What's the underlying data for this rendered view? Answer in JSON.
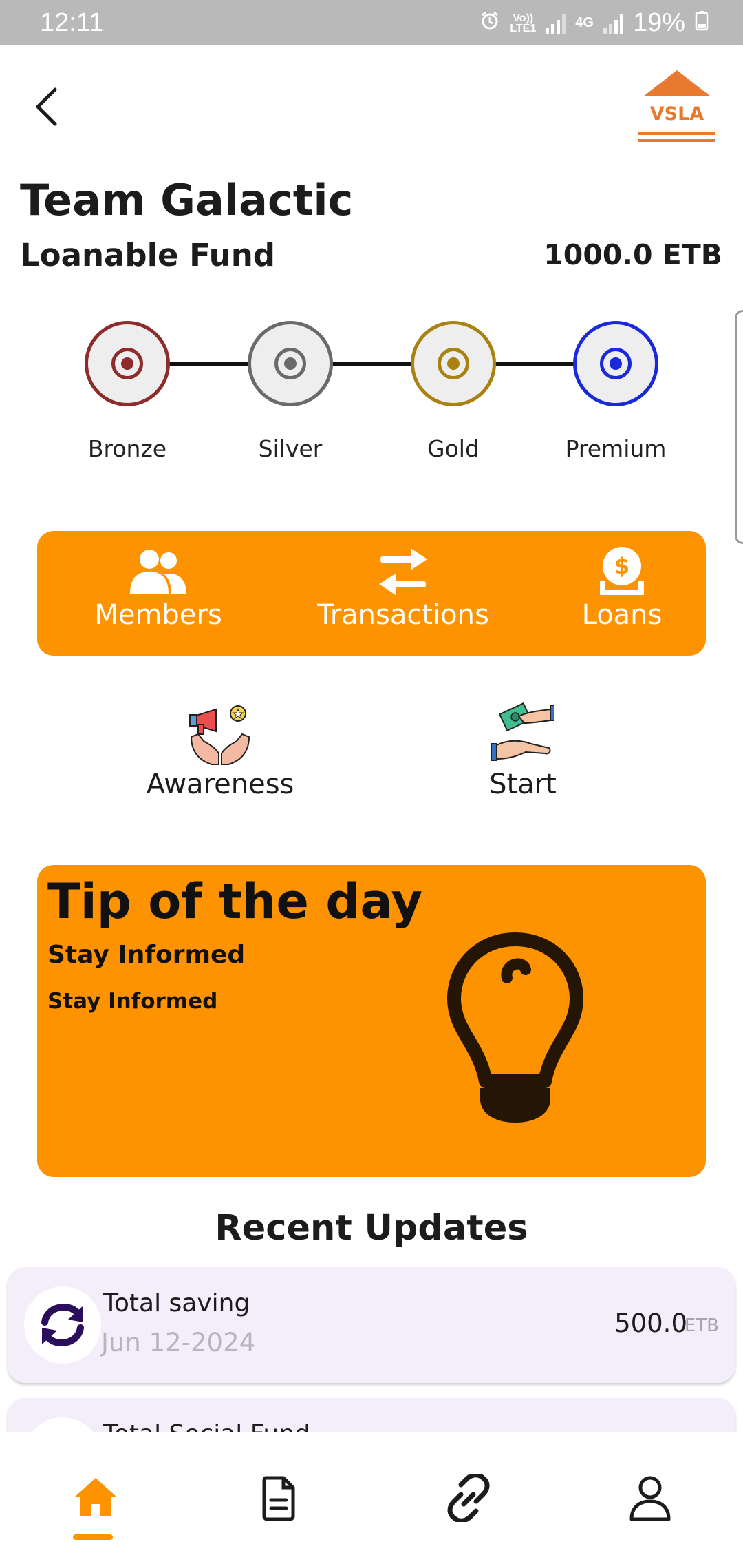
{
  "status_bar": {
    "time": "12:11",
    "network_label_top": "Vo))",
    "network_label_bottom": "LTE1",
    "network_type": "4G",
    "battery": "19%"
  },
  "header": {
    "logo_text": "VSLA",
    "team_name": "Team Galactic",
    "fund_label": "Loanable Fund",
    "fund_value": "1000.0 ETB"
  },
  "tiers": [
    {
      "label": "Bronze",
      "color": "#8e2b2b"
    },
    {
      "label": "Silver",
      "color": "#6a6a6a"
    },
    {
      "label": "Gold",
      "color": "#a98212"
    },
    {
      "label": "Premium",
      "color": "#1a2ad8"
    }
  ],
  "menu": {
    "members_label": "Members",
    "transactions_label": "Transactions",
    "loans_label": "Loans",
    "members_icon": "users-icon",
    "transactions_icon": "arrows-exchange-icon",
    "loans_icon": "money-hand-icon"
  },
  "actions": {
    "awareness_label": "Awareness",
    "start_label": "Start"
  },
  "tip": {
    "title": "Tip of the day",
    "subtitle": "Stay Informed",
    "body": "Stay Informed",
    "icon": "lightbulb-icon"
  },
  "updates": {
    "title": "Recent Updates",
    "items": [
      {
        "label": "Total saving",
        "date": "Jun 12-2024",
        "amount": "500.0",
        "unit": "ETB"
      },
      {
        "label": "Total Social Fund",
        "date": "",
        "amount": "",
        "unit": ""
      }
    ]
  },
  "nav": {
    "items": [
      "home-icon",
      "document-icon",
      "link-icon",
      "profile-icon"
    ],
    "active_index": 0
  },
  "colors": {
    "accent": "#fe9300",
    "logo": "#e8792e",
    "update_bg": "#f3eef9"
  }
}
